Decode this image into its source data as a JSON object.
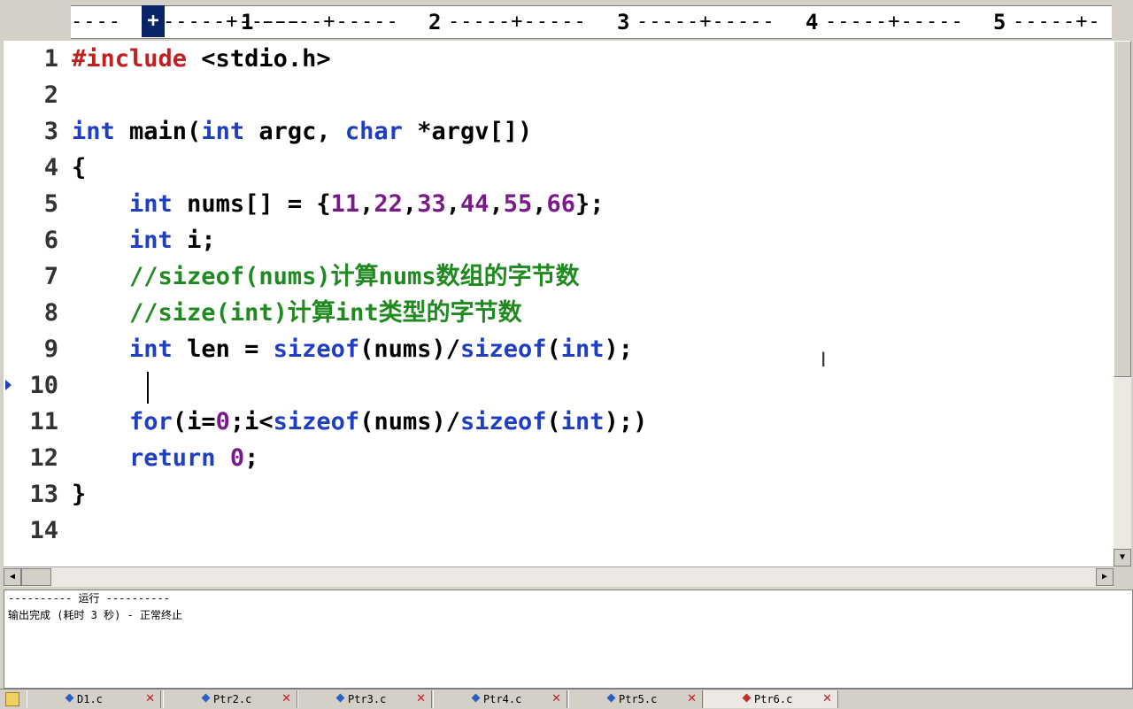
{
  "ruler": {
    "ticks": [
      "1",
      "2",
      "3",
      "4",
      "5"
    ],
    "cursor_glyph": "+"
  },
  "editor": {
    "lines": [
      {
        "num": "1",
        "tokens": [
          {
            "t": "#include",
            "c": "pp"
          },
          {
            "t": " <stdio.h>",
            "c": ""
          }
        ]
      },
      {
        "num": "2",
        "tokens": []
      },
      {
        "num": "3",
        "tokens": [
          {
            "t": "int",
            "c": "kw"
          },
          {
            "t": " main(",
            "c": ""
          },
          {
            "t": "int",
            "c": "kw"
          },
          {
            "t": " argc, ",
            "c": ""
          },
          {
            "t": "char",
            "c": "kw"
          },
          {
            "t": " *argv[])",
            "c": ""
          }
        ]
      },
      {
        "num": "4",
        "tokens": [
          {
            "t": "{",
            "c": ""
          }
        ]
      },
      {
        "num": "5",
        "tokens": [
          {
            "t": "    ",
            "c": ""
          },
          {
            "t": "int",
            "c": "kw"
          },
          {
            "t": " nums[] = {",
            "c": ""
          },
          {
            "t": "11",
            "c": "num"
          },
          {
            "t": ",",
            "c": ""
          },
          {
            "t": "22",
            "c": "num"
          },
          {
            "t": ",",
            "c": ""
          },
          {
            "t": "33",
            "c": "num"
          },
          {
            "t": ",",
            "c": ""
          },
          {
            "t": "44",
            "c": "num"
          },
          {
            "t": ",",
            "c": ""
          },
          {
            "t": "55",
            "c": "num"
          },
          {
            "t": ",",
            "c": ""
          },
          {
            "t": "66",
            "c": "num"
          },
          {
            "t": "};",
            "c": ""
          }
        ]
      },
      {
        "num": "6",
        "tokens": [
          {
            "t": "    ",
            "c": ""
          },
          {
            "t": "int",
            "c": "kw"
          },
          {
            "t": " i;",
            "c": ""
          }
        ]
      },
      {
        "num": "7",
        "tokens": [
          {
            "t": "    ",
            "c": ""
          },
          {
            "t": "//sizeof(nums)计算nums数组的字节数",
            "c": "cm"
          }
        ]
      },
      {
        "num": "8",
        "tokens": [
          {
            "t": "    ",
            "c": ""
          },
          {
            "t": "//size(int)计算int类型的字节数",
            "c": "cm"
          }
        ]
      },
      {
        "num": "9",
        "tokens": [
          {
            "t": "    ",
            "c": ""
          },
          {
            "t": "int",
            "c": "kw"
          },
          {
            "t": " len = ",
            "c": ""
          },
          {
            "t": "sizeof",
            "c": "kw"
          },
          {
            "t": "(nums)/",
            "c": ""
          },
          {
            "t": "sizeof",
            "c": "kw"
          },
          {
            "t": "(",
            "c": ""
          },
          {
            "t": "int",
            "c": "kw"
          },
          {
            "t": ");",
            "c": ""
          }
        ]
      },
      {
        "num": "10",
        "tokens": []
      },
      {
        "num": "11",
        "tokens": [
          {
            "t": "    ",
            "c": ""
          },
          {
            "t": "for",
            "c": "kw"
          },
          {
            "t": "(i=",
            "c": ""
          },
          {
            "t": "0",
            "c": "num"
          },
          {
            "t": ";i<",
            "c": ""
          },
          {
            "t": "sizeof",
            "c": "kw"
          },
          {
            "t": "(nums)/",
            "c": ""
          },
          {
            "t": "sizeof",
            "c": "kw"
          },
          {
            "t": "(",
            "c": ""
          },
          {
            "t": "int",
            "c": "kw"
          },
          {
            "t": ");)",
            "c": ""
          }
        ]
      },
      {
        "num": "12",
        "tokens": [
          {
            "t": "    ",
            "c": ""
          },
          {
            "t": "return",
            "c": "kw"
          },
          {
            "t": " ",
            "c": ""
          },
          {
            "t": "0",
            "c": "num"
          },
          {
            "t": ";",
            "c": ""
          }
        ]
      },
      {
        "num": "13",
        "tokens": [
          {
            "t": "}",
            "c": ""
          }
        ]
      },
      {
        "num": "14",
        "tokens": []
      }
    ]
  },
  "output": {
    "line1": "---------- 运行 ----------",
    "line2": "输出完成 (耗时 3 秒) - 正常终止"
  },
  "tabs": [
    {
      "label": "D1.c",
      "close": "✕",
      "active": false
    },
    {
      "label": "Ptr2.c",
      "close": "✕",
      "active": false
    },
    {
      "label": "Ptr3.c",
      "close": "✕",
      "active": false
    },
    {
      "label": "Ptr4.c",
      "close": "✕",
      "active": false
    },
    {
      "label": "Ptr5.c",
      "close": "✕",
      "active": false
    },
    {
      "label": "Ptr6.c",
      "close": "✕",
      "active": true
    }
  ],
  "colors": {
    "keyword": "#1f3fc2",
    "preprocessor": "#c02020",
    "number": "#7a1a8a",
    "comment": "#1f8a1f"
  }
}
